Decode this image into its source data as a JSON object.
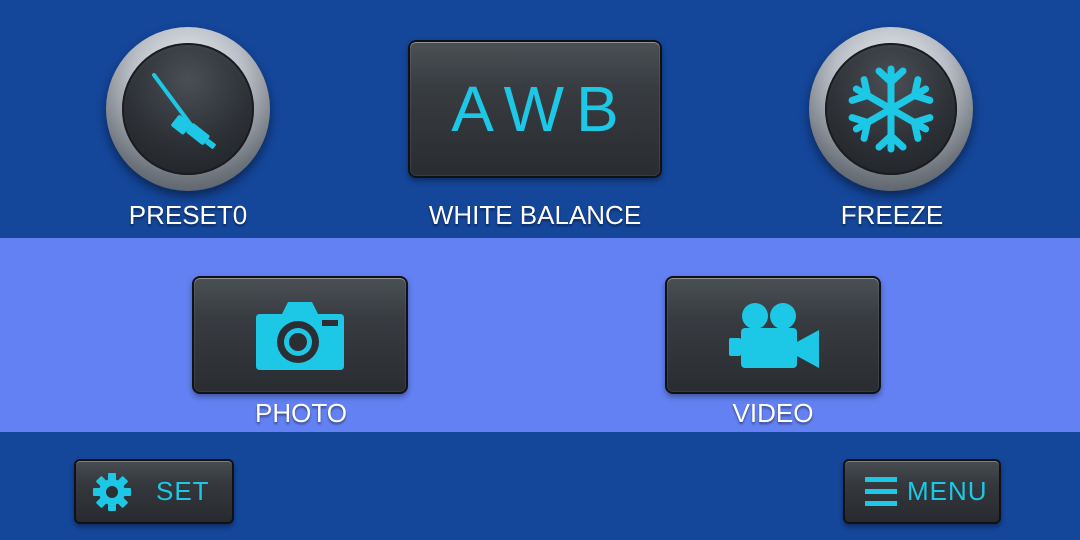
{
  "colors": {
    "background": "#14469a",
    "band": "#6381f2",
    "accent": "#1cc8e6",
    "label": "#ffffff"
  },
  "top_row": {
    "preset": {
      "label": "PRESET0",
      "icon": "scope-icon"
    },
    "white_balance": {
      "button_text": "AWB",
      "label": "WHITE BALANCE"
    },
    "freeze": {
      "label": "FREEZE",
      "icon": "snowflake-icon"
    }
  },
  "middle_row": {
    "photo": {
      "label": "PHOTO",
      "icon": "camera-icon"
    },
    "video": {
      "label": "VIDEO",
      "icon": "video-camera-icon"
    }
  },
  "bottom_row": {
    "set": {
      "label": "SET",
      "icon": "gear-icon"
    },
    "menu": {
      "label": "MENU",
      "icon": "hamburger-menu-icon"
    }
  }
}
